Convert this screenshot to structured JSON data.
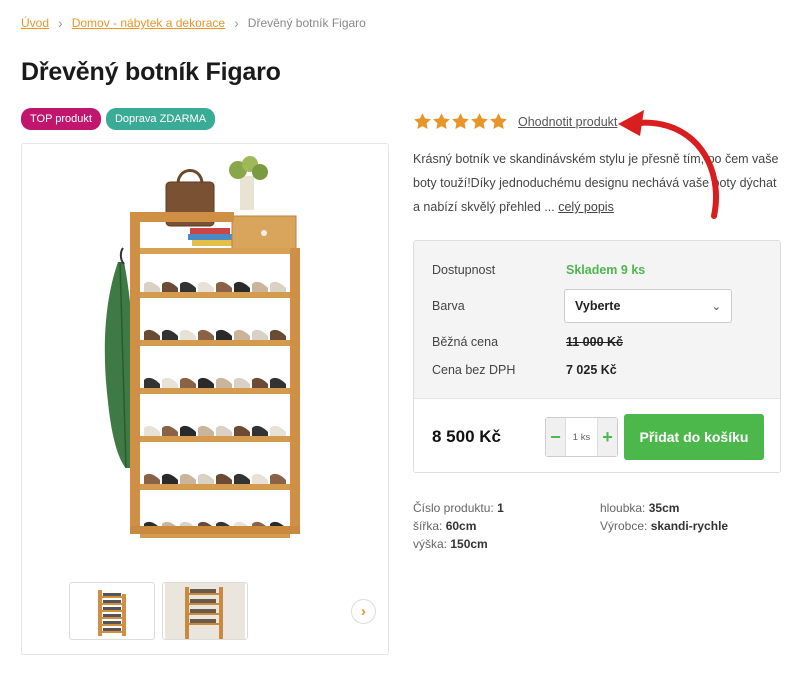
{
  "breadcrumb": {
    "home": "Úvod",
    "category": "Domov - nábytek a dekorace",
    "current": "Dřevěný botník Figaro"
  },
  "product": {
    "title": "Dřevěný botník Figaro",
    "badges": {
      "top": "TOP produkt",
      "shipping": "Doprava ZDARMA"
    },
    "rating": {
      "stars": 5,
      "max": 5,
      "link": "Ohodnotit produkt"
    },
    "description": "Krásný botník ve skandinávském stylu je přesně tím, po čem vaše boty touží!Díky jednoduchému designu nechává vaše boty dýchat a nabízí skvělý přehled ...",
    "more_link": "celý popis"
  },
  "info": {
    "availability_label": "Dostupnost",
    "availability_value": "Skladem 9 ks",
    "color_label": "Barva",
    "color_select": "Vyberte",
    "regular_price_label": "Běžná cena",
    "regular_price_value": "11 000 Kč",
    "price_no_vat_label": "Cena bez DPH",
    "price_no_vat_value": "7 025 Kč",
    "price": "8 500 Kč",
    "quantity": "1 ks",
    "add_to_cart": "Přidat do košíku"
  },
  "specs": {
    "product_no_label": "Číslo produktu:",
    "product_no": "1",
    "width_label": "šířka:",
    "width": "60cm",
    "height_label": "výška:",
    "height": "150cm",
    "depth_label": "hloubka:",
    "depth": "35cm",
    "maker_label": "Výrobce:",
    "maker": "skandi-rychle"
  },
  "colors": {
    "accent": "#e8962a",
    "badge_top": "#c0166e",
    "badge_free": "#3aab94",
    "stock_green": "#4db84d",
    "cart_green": "#4cb84c",
    "arrow_red": "#d81e1e"
  },
  "icons": {
    "star": "star-icon",
    "next": "chevron-right-icon",
    "select": "chevron-down-icon"
  }
}
